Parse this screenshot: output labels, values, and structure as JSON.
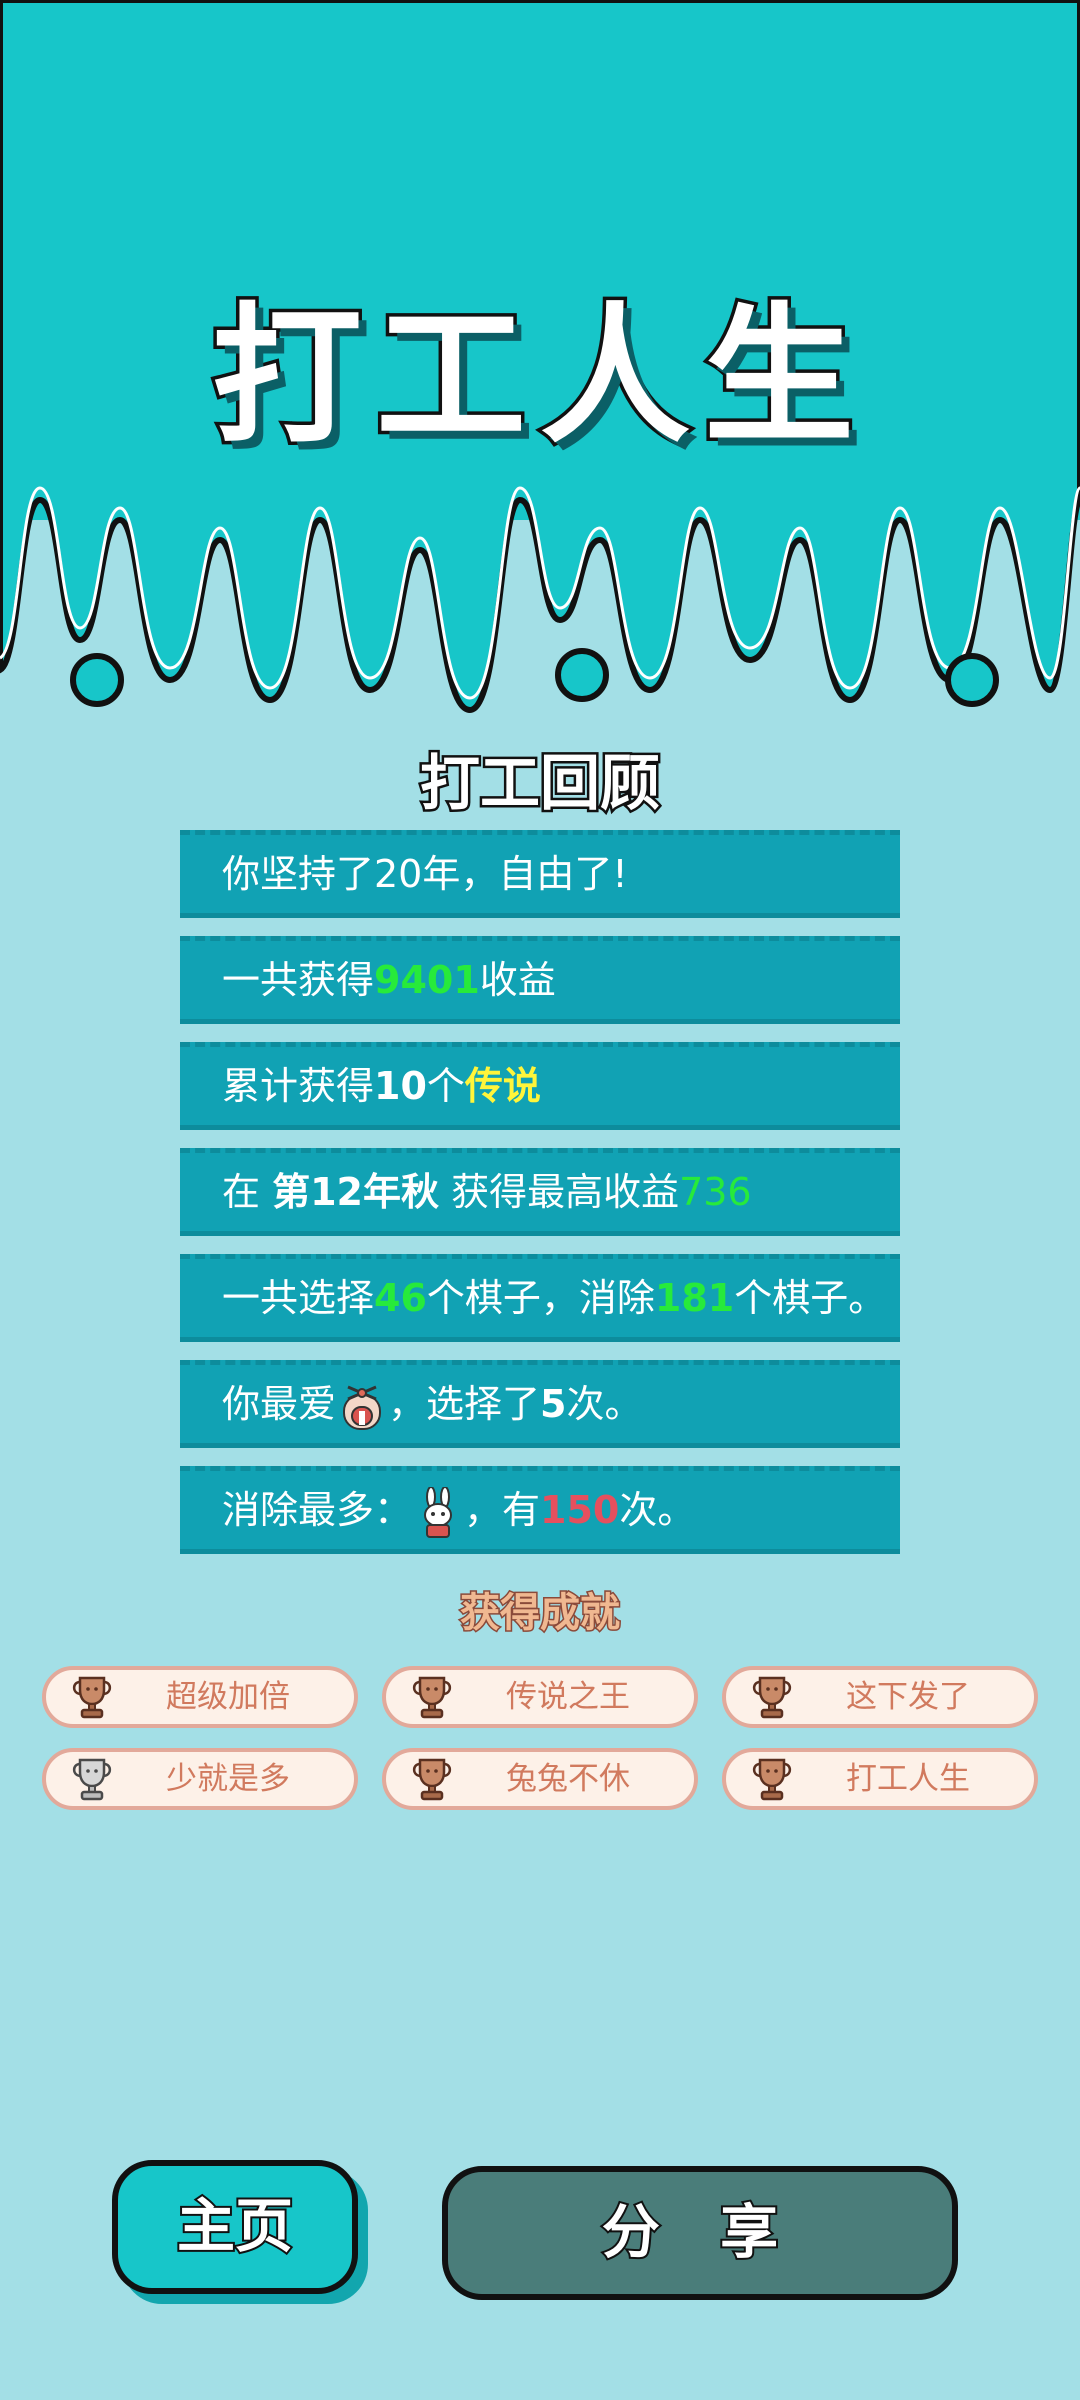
{
  "title": "打工人生",
  "review_title": "打工回顾",
  "rows": {
    "r1": "你坚持了20年，自由了!",
    "r2": {
      "pre": "一共获得",
      "num": "9401",
      "post": "收益"
    },
    "r3": {
      "pre": "累计获得",
      "num": "10",
      "mid": "个",
      "hl": "传说"
    },
    "r4": {
      "pre": "在 ",
      "bold": "第12年秋",
      "mid": " 获得最高收益",
      "num": "736"
    },
    "r5": {
      "pre": "一共选择",
      "num1": "46",
      "mid": "个棋子，消除",
      "num2": "181",
      "post": "个棋子。"
    },
    "r6": {
      "pre": "你最爱",
      "icon": "carousel-icon",
      "mid": "，选择了",
      "num": "5",
      "post": "次。"
    },
    "r7": {
      "pre": "消除最多：",
      "icon": "rabbit-icon",
      "mid": "，有",
      "num": "150",
      "post": "次。"
    }
  },
  "achievements_title": "获得成就",
  "achievements": [
    "超级加倍",
    "传说之王",
    "这下发了",
    "少就是多",
    "兔兔不休",
    "打工人生"
  ],
  "buttons": {
    "home": "主页",
    "share": "分 享"
  },
  "colors": {
    "top_bg": "#17c6c9",
    "page_bg": "#a3dfe6",
    "row_bg": "#11a2b4",
    "green": "#27ea3b",
    "red": "#e5505e",
    "yellow": "#fff53a"
  }
}
